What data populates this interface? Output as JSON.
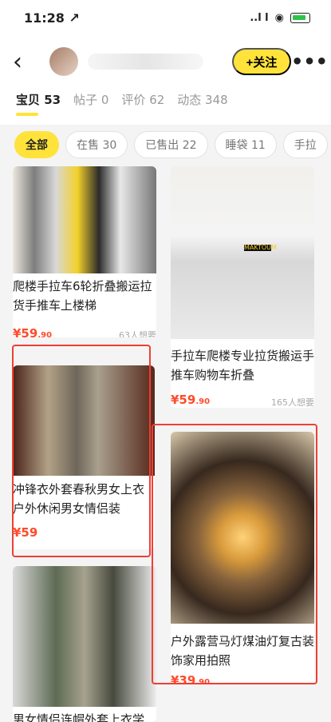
{
  "status": {
    "time": "11:28 ↗",
    "signal": "..l l"
  },
  "header": {
    "back": "‹",
    "follow": "+关注",
    "more": "•••"
  },
  "tabs": [
    "宝贝 53",
    "帖子 0",
    "评价 62",
    "动态 348"
  ],
  "filters": [
    "全部",
    "在售 30",
    "已售出 22",
    "睡袋 11",
    "手拉"
  ],
  "items": [
    {
      "title": "爬楼手拉车6轮折叠搬运拉货手推车上楼梯",
      "price": "¥59",
      "price_suffix": ".90",
      "wants": "63人想要"
    },
    {
      "title": "手拉车爬楼专业拉货搬运手推车购物车折叠",
      "price": "¥59",
      "price_suffix": ".90",
      "wants": "165人想要",
      "image_text": "MAKTOUM"
    },
    {
      "title": "冲锋衣外套春秋男女上衣户外休闲男女情侣装",
      "price": "¥59",
      "price_suffix": ""
    },
    {
      "title": "户外露营马灯煤油灯复古装饰家用拍照",
      "price": "¥39",
      "price_suffix": ".90"
    },
    {
      "title": "男女情侣连帽外套上衣学",
      "price": "",
      "price_suffix": ""
    }
  ]
}
